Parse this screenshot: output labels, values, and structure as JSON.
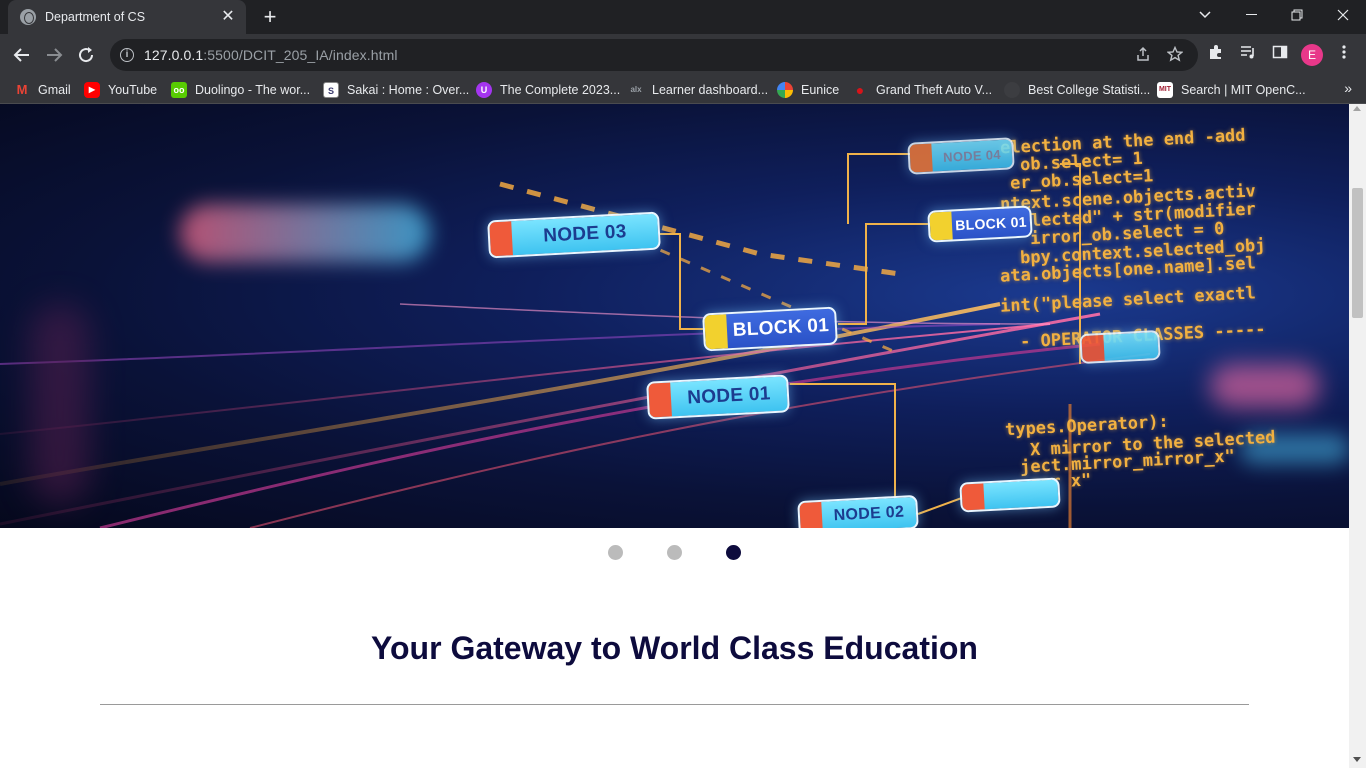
{
  "browser": {
    "tab_title": "Department of CS",
    "tab_close": "✕",
    "new_tab": "+",
    "url_host": "127.0.0.1",
    "url_rest": ":5500/DCIT_205_IA/index.html",
    "profile_initial": "E",
    "bookmarks_more": "»",
    "bookmarks": [
      {
        "label": "Gmail",
        "icon": "gmail-icon",
        "color": "#ea4335",
        "glyph": "M"
      },
      {
        "label": "YouTube",
        "icon": "youtube-icon",
        "color": "#ff0000",
        "glyph": "▶"
      },
      {
        "label": "Duolingo - The wor...",
        "icon": "duolingo-icon",
        "color": "#58cc02",
        "glyph": "oo"
      },
      {
        "label": "Sakai : Home : Over...",
        "icon": "sakai-icon",
        "color": "#3b3b6d",
        "glyph": "S"
      },
      {
        "label": "The Complete 2023...",
        "icon": "udemy-icon",
        "color": "#a435f0",
        "glyph": "U"
      },
      {
        "label": "Learner dashboard...",
        "icon": "alx-icon",
        "color": "#4a4b4f",
        "glyph": "alx"
      },
      {
        "label": "Eunice",
        "icon": "photos-icon",
        "color": "#4285f4",
        "glyph": "✿"
      },
      {
        "label": "Grand Theft Auto V...",
        "icon": "gta-icon",
        "color": "#d7141a",
        "glyph": "●"
      },
      {
        "label": "Best College Statisti...",
        "icon": "globe-icon",
        "color": "#3c3d41",
        "glyph": ""
      },
      {
        "label": "Search | MIT OpenC...",
        "icon": "mit-ocw-icon",
        "color": "#a31f34",
        "glyph": "MIT"
      }
    ]
  },
  "hero": {
    "node_labels": [
      "NODE 03",
      "BLOCK 01",
      "NODE 01",
      "NODE 02",
      "NODE 04",
      "BLOCK 01"
    ],
    "code_lines": [
      "election at the end -add",
      "ob.select= 1",
      "er_ob.select=1",
      "ntext.scene.objects.activ",
      "\"Selected\" + str(modifier",
      "irror_ob.select = 0",
      "bpy.context.selected_obj",
      "ata.objects[one.name].sel",
      "int(\"please select exactl",
      "- OPERATOR CLASSES -----",
      "types.Operator):",
      "X mirror to the selected",
      "ject.mirror_mirror_x\"",
      "ror x\""
    ]
  },
  "carousel": {
    "slides": 3,
    "active_index": 2
  },
  "main": {
    "headline": "Your Gateway to World Class Education"
  },
  "colors": {
    "accent_navy": "#0d0b3d",
    "dot_inactive": "#bbbbbb",
    "chrome_dark": "#202124",
    "chrome_toolbar": "#35363a"
  }
}
